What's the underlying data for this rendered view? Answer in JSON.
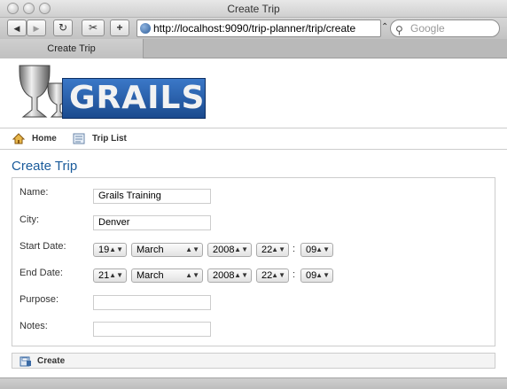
{
  "window": {
    "title": "Create Trip"
  },
  "toolbar": {
    "back_label": "◀",
    "forward_label": "▶",
    "reload_label": "↻",
    "bookmark_label": "✂",
    "add_label": "+",
    "url": "http://localhost:9090/trip-planner/trip/create",
    "search_placeholder": "Google"
  },
  "tabs": [
    {
      "label": "Create Trip"
    }
  ],
  "logo": {
    "text": "GRAILS"
  },
  "nav": {
    "home_label": "Home",
    "triplist_label": "Trip List"
  },
  "page": {
    "heading": "Create Trip"
  },
  "form": {
    "name": {
      "label": "Name:",
      "value": "Grails Training"
    },
    "city": {
      "label": "City:",
      "value": "Denver"
    },
    "start_date": {
      "label": "Start Date:",
      "day": "19",
      "month": "March",
      "year": "2008",
      "hour": "22",
      "minute": "09"
    },
    "end_date": {
      "label": "End Date:",
      "day": "21",
      "month": "March",
      "year": "2008",
      "hour": "22",
      "minute": "09"
    },
    "purpose": {
      "label": "Purpose:",
      "value": ""
    },
    "notes": {
      "label": "Notes:",
      "value": ""
    },
    "time_separator": ":"
  },
  "actions": {
    "create_label": "Create"
  },
  "colors": {
    "heading": "#1a5b9b",
    "logo_blue": "#2a62ad"
  }
}
